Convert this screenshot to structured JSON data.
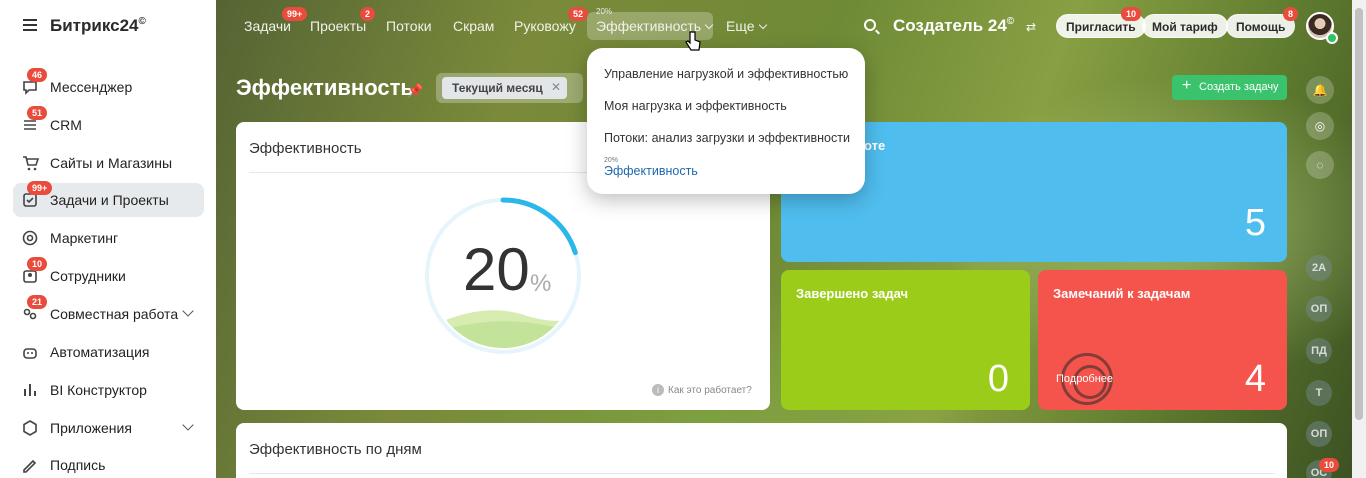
{
  "sidebar": {
    "brand": "Битрикс24",
    "brand_mark": "©",
    "items": [
      {
        "label": "Мессенджер",
        "badge": "46",
        "icon": "chat-icon"
      },
      {
        "label": "CRM",
        "badge": "51",
        "icon": "crm-icon"
      },
      {
        "label": "Сайты и Магазины",
        "badge": "",
        "icon": "cart-icon"
      },
      {
        "label": "Задачи и Проекты",
        "badge": "99+",
        "icon": "tasks-icon"
      },
      {
        "label": "Маркетинг",
        "badge": "",
        "icon": "target-icon"
      },
      {
        "label": "Сотрудники",
        "badge": "10",
        "icon": "people-icon"
      },
      {
        "label": "Совместная работа",
        "badge": "21",
        "icon": "collab-icon"
      },
      {
        "label": "Автоматизация",
        "badge": "",
        "icon": "robot-icon"
      },
      {
        "label": "BI Конструктор",
        "badge": "",
        "icon": "bar-chart-icon"
      },
      {
        "label": "Приложения",
        "badge": "",
        "icon": "apps-icon"
      },
      {
        "label": "Подпись",
        "badge": "",
        "icon": "signature-icon"
      }
    ]
  },
  "topbar": {
    "tabs": [
      {
        "label": "Задачи",
        "badge": "99+"
      },
      {
        "label": "Проекты",
        "badge": "2"
      },
      {
        "label": "Потоки",
        "badge": ""
      },
      {
        "label": "Скрам",
        "badge": ""
      },
      {
        "label": "Руковожу",
        "badge": "52"
      },
      {
        "label": "Эффективность",
        "badge": "",
        "sup": "20%"
      },
      {
        "label": "Еще",
        "badge": ""
      }
    ],
    "portal": "Создатель 24",
    "portal_mark": "©",
    "invite": {
      "label": "Пригласить",
      "badge": "10"
    },
    "tariff": {
      "label": "Мой тариф"
    },
    "help": {
      "label": "Помощь",
      "badge": "8"
    }
  },
  "page": {
    "title": "Эффективность",
    "filter_chip": "Текущий месяц",
    "create_button": "Создать задачу"
  },
  "dropdown": {
    "items": [
      "Управление нагрузкой и эффективностью",
      "Моя нагрузка и эффективность",
      "Потоки: анализ загрузки и эффективности"
    ],
    "active_sup": "20%",
    "active": "Эффективность"
  },
  "efficiency_card": {
    "title": "Эффективность",
    "value": "20",
    "unit": "%",
    "progress": 0.2,
    "how_link": "Как это работает?"
  },
  "stats": {
    "in_work": {
      "title": "боте",
      "value": "5",
      "color": "#4fbdee"
    },
    "completed": {
      "title": "Завершено задач",
      "value": "0",
      "color": "#9bcc1a"
    },
    "remarks": {
      "title": "Замечаний к задачам",
      "value": "4",
      "more": "Подробнее",
      "color": "#f4544c"
    }
  },
  "daily_card": {
    "title": "Эффективность по дням"
  },
  "rail": {
    "avatars": [
      "2А",
      "ОП",
      "ПД",
      "Т",
      "ОП",
      "ОС"
    ],
    "last_badge": "10"
  }
}
